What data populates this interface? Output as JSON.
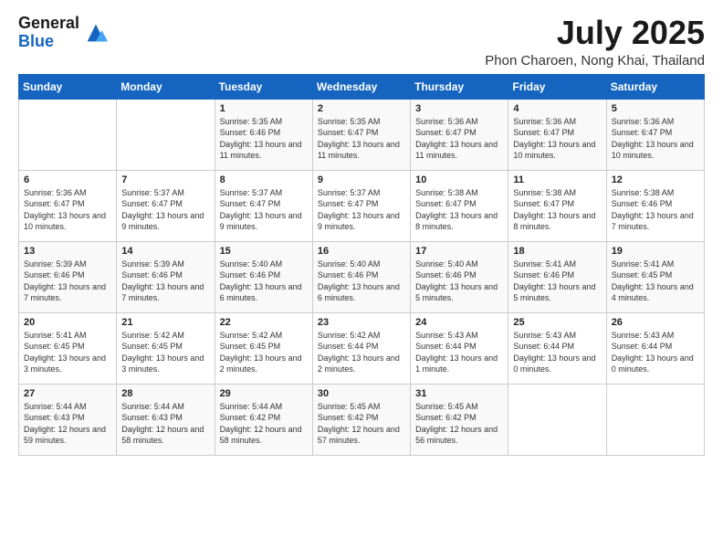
{
  "logo": {
    "general": "General",
    "blue": "Blue"
  },
  "title": "July 2025",
  "subtitle": "Phon Charoen, Nong Khai, Thailand",
  "days_header": [
    "Sunday",
    "Monday",
    "Tuesday",
    "Wednesday",
    "Thursday",
    "Friday",
    "Saturday"
  ],
  "weeks": [
    [
      {
        "num": "",
        "detail": ""
      },
      {
        "num": "",
        "detail": ""
      },
      {
        "num": "1",
        "detail": "Sunrise: 5:35 AM\nSunset: 6:46 PM\nDaylight: 13 hours and 11 minutes."
      },
      {
        "num": "2",
        "detail": "Sunrise: 5:35 AM\nSunset: 6:47 PM\nDaylight: 13 hours and 11 minutes."
      },
      {
        "num": "3",
        "detail": "Sunrise: 5:36 AM\nSunset: 6:47 PM\nDaylight: 13 hours and 11 minutes."
      },
      {
        "num": "4",
        "detail": "Sunrise: 5:36 AM\nSunset: 6:47 PM\nDaylight: 13 hours and 10 minutes."
      },
      {
        "num": "5",
        "detail": "Sunrise: 5:36 AM\nSunset: 6:47 PM\nDaylight: 13 hours and 10 minutes."
      }
    ],
    [
      {
        "num": "6",
        "detail": "Sunrise: 5:36 AM\nSunset: 6:47 PM\nDaylight: 13 hours and 10 minutes."
      },
      {
        "num": "7",
        "detail": "Sunrise: 5:37 AM\nSunset: 6:47 PM\nDaylight: 13 hours and 9 minutes."
      },
      {
        "num": "8",
        "detail": "Sunrise: 5:37 AM\nSunset: 6:47 PM\nDaylight: 13 hours and 9 minutes."
      },
      {
        "num": "9",
        "detail": "Sunrise: 5:37 AM\nSunset: 6:47 PM\nDaylight: 13 hours and 9 minutes."
      },
      {
        "num": "10",
        "detail": "Sunrise: 5:38 AM\nSunset: 6:47 PM\nDaylight: 13 hours and 8 minutes."
      },
      {
        "num": "11",
        "detail": "Sunrise: 5:38 AM\nSunset: 6:47 PM\nDaylight: 13 hours and 8 minutes."
      },
      {
        "num": "12",
        "detail": "Sunrise: 5:38 AM\nSunset: 6:46 PM\nDaylight: 13 hours and 7 minutes."
      }
    ],
    [
      {
        "num": "13",
        "detail": "Sunrise: 5:39 AM\nSunset: 6:46 PM\nDaylight: 13 hours and 7 minutes."
      },
      {
        "num": "14",
        "detail": "Sunrise: 5:39 AM\nSunset: 6:46 PM\nDaylight: 13 hours and 7 minutes."
      },
      {
        "num": "15",
        "detail": "Sunrise: 5:40 AM\nSunset: 6:46 PM\nDaylight: 13 hours and 6 minutes."
      },
      {
        "num": "16",
        "detail": "Sunrise: 5:40 AM\nSunset: 6:46 PM\nDaylight: 13 hours and 6 minutes."
      },
      {
        "num": "17",
        "detail": "Sunrise: 5:40 AM\nSunset: 6:46 PM\nDaylight: 13 hours and 5 minutes."
      },
      {
        "num": "18",
        "detail": "Sunrise: 5:41 AM\nSunset: 6:46 PM\nDaylight: 13 hours and 5 minutes."
      },
      {
        "num": "19",
        "detail": "Sunrise: 5:41 AM\nSunset: 6:45 PM\nDaylight: 13 hours and 4 minutes."
      }
    ],
    [
      {
        "num": "20",
        "detail": "Sunrise: 5:41 AM\nSunset: 6:45 PM\nDaylight: 13 hours and 3 minutes."
      },
      {
        "num": "21",
        "detail": "Sunrise: 5:42 AM\nSunset: 6:45 PM\nDaylight: 13 hours and 3 minutes."
      },
      {
        "num": "22",
        "detail": "Sunrise: 5:42 AM\nSunset: 6:45 PM\nDaylight: 13 hours and 2 minutes."
      },
      {
        "num": "23",
        "detail": "Sunrise: 5:42 AM\nSunset: 6:44 PM\nDaylight: 13 hours and 2 minutes."
      },
      {
        "num": "24",
        "detail": "Sunrise: 5:43 AM\nSunset: 6:44 PM\nDaylight: 13 hours and 1 minute."
      },
      {
        "num": "25",
        "detail": "Sunrise: 5:43 AM\nSunset: 6:44 PM\nDaylight: 13 hours and 0 minutes."
      },
      {
        "num": "26",
        "detail": "Sunrise: 5:43 AM\nSunset: 6:44 PM\nDaylight: 13 hours and 0 minutes."
      }
    ],
    [
      {
        "num": "27",
        "detail": "Sunrise: 5:44 AM\nSunset: 6:43 PM\nDaylight: 12 hours and 59 minutes."
      },
      {
        "num": "28",
        "detail": "Sunrise: 5:44 AM\nSunset: 6:43 PM\nDaylight: 12 hours and 58 minutes."
      },
      {
        "num": "29",
        "detail": "Sunrise: 5:44 AM\nSunset: 6:42 PM\nDaylight: 12 hours and 58 minutes."
      },
      {
        "num": "30",
        "detail": "Sunrise: 5:45 AM\nSunset: 6:42 PM\nDaylight: 12 hours and 57 minutes."
      },
      {
        "num": "31",
        "detail": "Sunrise: 5:45 AM\nSunset: 6:42 PM\nDaylight: 12 hours and 56 minutes."
      },
      {
        "num": "",
        "detail": ""
      },
      {
        "num": "",
        "detail": ""
      }
    ]
  ]
}
